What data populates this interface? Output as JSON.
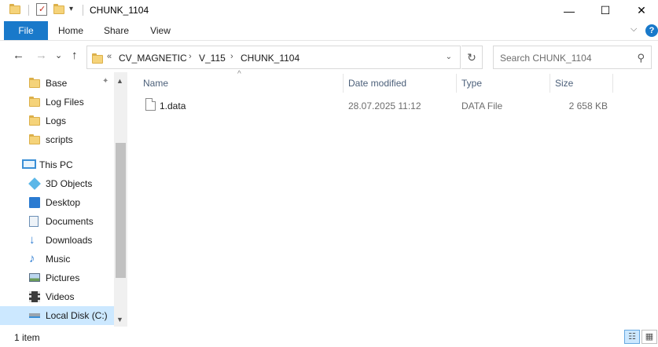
{
  "window": {
    "title": "CHUNK_1104",
    "minimize": "—",
    "maximize": "☐",
    "close": "✕",
    "qa_dropdown": "▾"
  },
  "ribbon": {
    "tabs": [
      "File",
      "Home",
      "Share",
      "View"
    ],
    "expand_glyph": "⌵",
    "help_glyph": "?"
  },
  "nav": {
    "back_glyph": "←",
    "forward_glyph": "→",
    "recent_glyph": "⌄",
    "up_glyph": "↑",
    "address_prefix": "«",
    "breadcrumbs": [
      "CV_MAGNETIC",
      "V_115",
      "CHUNK_1104"
    ],
    "crumb_sep": "›",
    "address_dropdown": "⌄",
    "refresh_glyph": "↻",
    "search_placeholder": "Search CHUNK_1104",
    "search_glyph": "⚲"
  },
  "sidebar": {
    "items": [
      {
        "label": "Base",
        "icon": "folder-icon",
        "pinned": true
      },
      {
        "label": "Log Files",
        "icon": "folder-icon"
      },
      {
        "label": "Logs",
        "icon": "folder-icon"
      },
      {
        "label": "scripts",
        "icon": "folder-icon"
      },
      {
        "label": "This PC",
        "icon": "computer-icon"
      },
      {
        "label": "3D Objects",
        "icon": "3d-objects-icon"
      },
      {
        "label": "Desktop",
        "icon": "desktop-icon"
      },
      {
        "label": "Documents",
        "icon": "documents-icon"
      },
      {
        "label": "Downloads",
        "icon": "downloads-icon"
      },
      {
        "label": "Music",
        "icon": "music-icon"
      },
      {
        "label": "Pictures",
        "icon": "pictures-icon"
      },
      {
        "label": "Videos",
        "icon": "videos-icon"
      },
      {
        "label": "Local Disk (C:)",
        "icon": "local-disk-icon",
        "selected": true
      }
    ],
    "pin_glyph": "📌",
    "scroll_up": "▲",
    "scroll_down": "▼"
  },
  "filelist": {
    "columns": [
      "Name",
      "Date modified",
      "Type",
      "Size"
    ],
    "sort_glyph": "^",
    "rows": [
      {
        "name": "1.data",
        "date": "28.07.2025 11:12",
        "type": "DATA File",
        "size": "2 658 KB"
      }
    ]
  },
  "status": {
    "count": "1 item",
    "details_view_glyph": "☷",
    "tiles_view_glyph": "▦"
  },
  "colors": {
    "accent": "#1979ca",
    "selected": "#cce8ff",
    "folder": "#f5d37a"
  }
}
